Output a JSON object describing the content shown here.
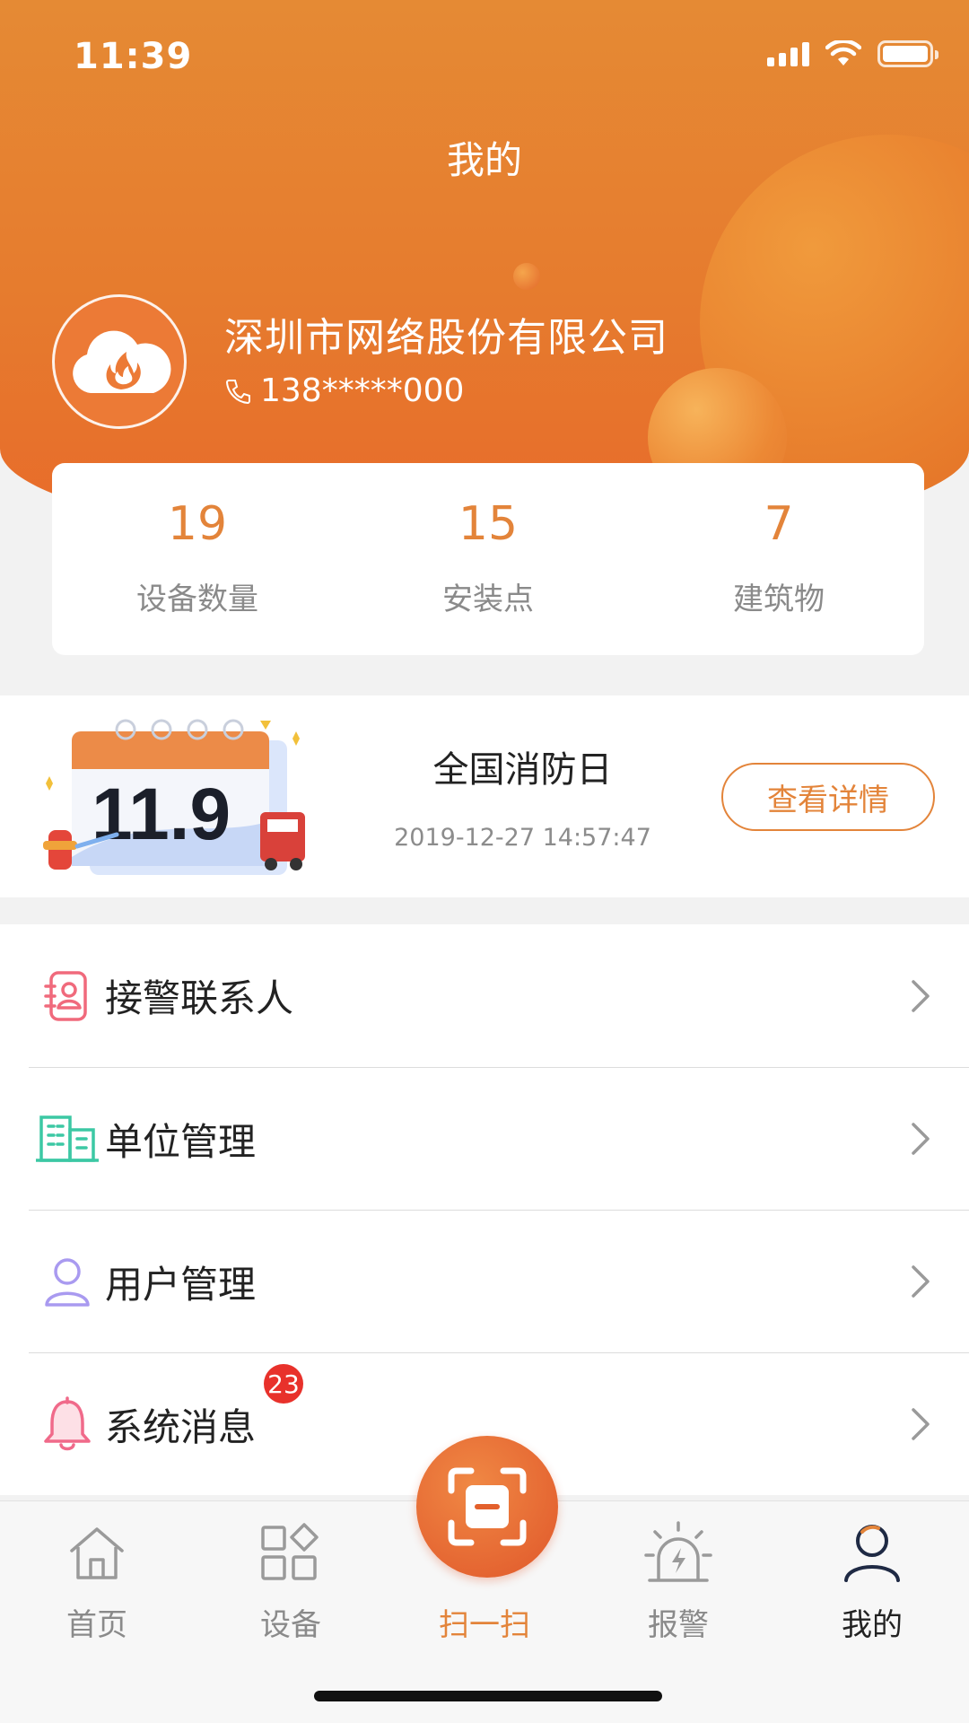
{
  "status_bar": {
    "time": "11:39"
  },
  "header": {
    "title": "我的"
  },
  "profile": {
    "company": "深圳市网络股份有限公司",
    "phone": "138*****000"
  },
  "stats": [
    {
      "value": "19",
      "label": "设备数量"
    },
    {
      "value": "15",
      "label": "安装点"
    },
    {
      "value": "7",
      "label": "建筑物"
    }
  ],
  "banner": {
    "image_text": "11.9",
    "title": "全国消防日",
    "time": "2019-12-27 14:57:47",
    "button": "查看详情"
  },
  "menu": [
    {
      "label": "接警联系人",
      "icon": "contact-book-icon"
    },
    {
      "label": "单位管理",
      "icon": "building-icon"
    },
    {
      "label": "用户管理",
      "icon": "user-icon"
    },
    {
      "label": "系统消息",
      "icon": "bell-icon",
      "badge": "23"
    }
  ],
  "tabs": [
    {
      "label": "首页",
      "icon": "home-icon"
    },
    {
      "label": "设备",
      "icon": "devices-icon"
    },
    {
      "label": "扫一扫",
      "icon": "scan-icon"
    },
    {
      "label": "报警",
      "icon": "alarm-icon"
    },
    {
      "label": "我的",
      "icon": "profile-icon"
    }
  ],
  "colors": {
    "accent": "#e3843a",
    "header": "#e67b2e",
    "badge": "#e8312b"
  }
}
